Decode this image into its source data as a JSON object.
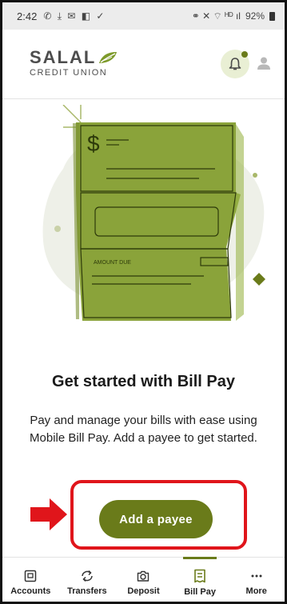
{
  "status_bar": {
    "time": "2:42",
    "left_icons": "✆ ⤓ ✉ ◧ ✓",
    "right_icons": "⚭ ✕ ⌔ ᴴᴰ ıl",
    "battery": "92%"
  },
  "header": {
    "logo_main": "SALAL",
    "logo_sub": "CREDIT UNION",
    "notification_icon": "bell-icon",
    "profile_icon": "person-icon"
  },
  "illustration": {
    "dollar": "$",
    "amount_due_label": "AMOUNT DUE"
  },
  "main": {
    "headline": "Get started with Bill Pay",
    "description": "Pay and manage your bills with ease using Mobile Bill Pay. Add a payee to get started.",
    "add_payee_label": "Add a payee"
  },
  "bottom_nav": {
    "items": [
      {
        "label": "Accounts",
        "icon": "accounts-icon"
      },
      {
        "label": "Transfers",
        "icon": "transfers-icon"
      },
      {
        "label": "Deposit",
        "icon": "camera-icon"
      },
      {
        "label": "Bill Pay",
        "icon": "bill-icon",
        "active": true
      },
      {
        "label": "More",
        "icon": "more-icon"
      }
    ]
  },
  "colors": {
    "brand_green": "#6a7b1a",
    "check_green": "#8aa33a",
    "annotation_red": "#e0151b"
  }
}
